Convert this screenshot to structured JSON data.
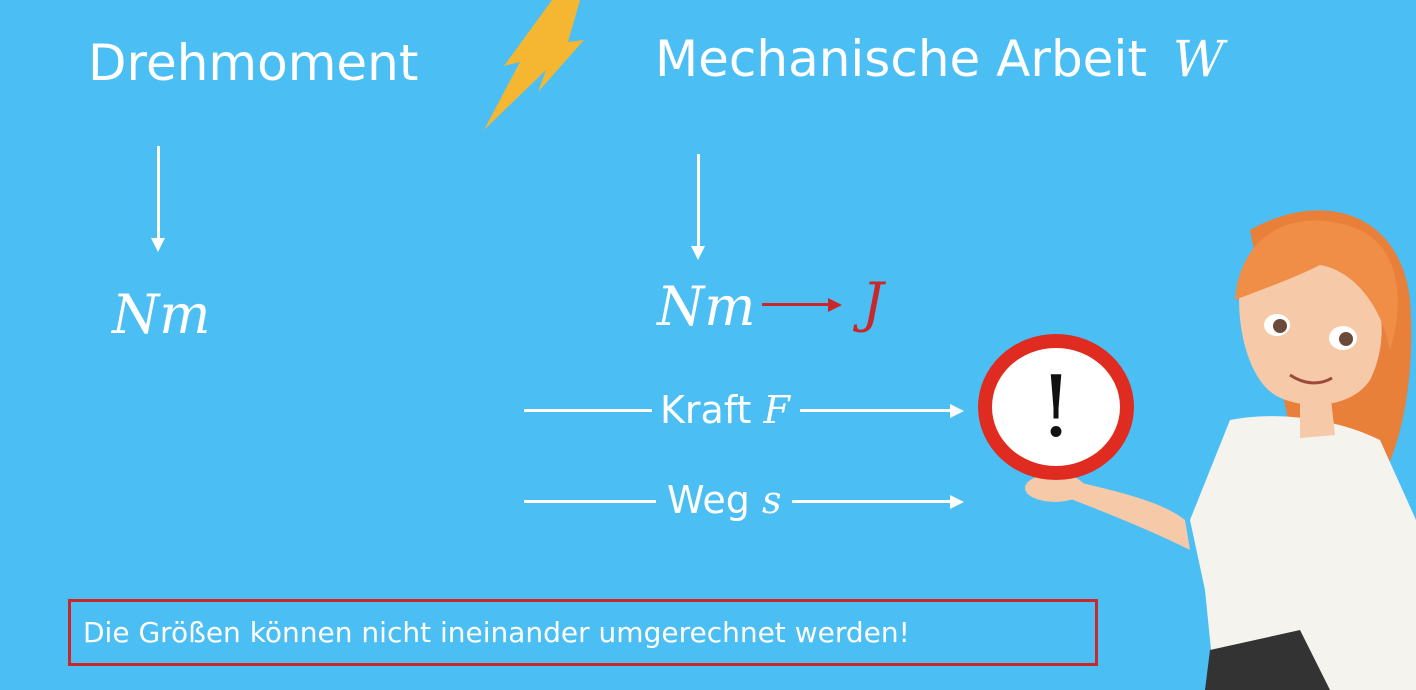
{
  "left": {
    "title": "Drehmoment",
    "unit": "Nm"
  },
  "right": {
    "title": "Mechanische Arbeit",
    "symbol": "W",
    "unit": "Nm",
    "converted_unit": "J"
  },
  "factors": [
    {
      "label": "Kraft",
      "symbol": "F"
    },
    {
      "label": "Weg",
      "symbol": "s"
    }
  ],
  "warning_sign": {
    "text": "!"
  },
  "notice": {
    "text": "Die Größen können nicht ineinander umgerechnet werden!"
  },
  "colors": {
    "background": "#4bbef4",
    "text": "#ffffff",
    "accent_red": "#c9282a",
    "lightning": "#f5b731"
  },
  "icons": [
    "lightning-icon",
    "warning-sign-icon"
  ]
}
